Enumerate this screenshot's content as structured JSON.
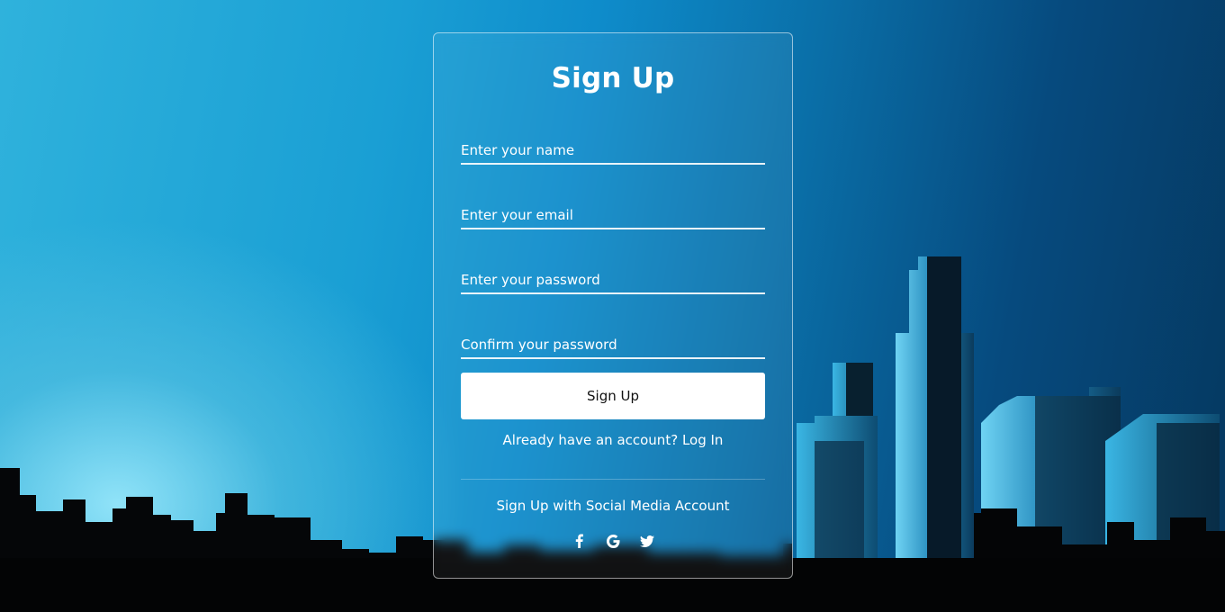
{
  "form": {
    "title": "Sign Up",
    "name_placeholder": "Enter your name",
    "email_placeholder": "Enter your email",
    "password_placeholder": "Enter your password",
    "confirm_placeholder": "Confirm your password",
    "submit_label": "Sign Up",
    "login_prompt": "Already have an account?",
    "login_link": "Log In",
    "social_title": "Sign Up with Social Media Account"
  },
  "social": [
    {
      "icon": "facebook-icon"
    },
    {
      "icon": "google-icon"
    },
    {
      "icon": "twitter-icon"
    }
  ],
  "colors": {
    "sky_light": "#2fb2dc",
    "sky_dark": "#05385f",
    "button_bg": "#ffffff",
    "text": "#ffffff"
  }
}
